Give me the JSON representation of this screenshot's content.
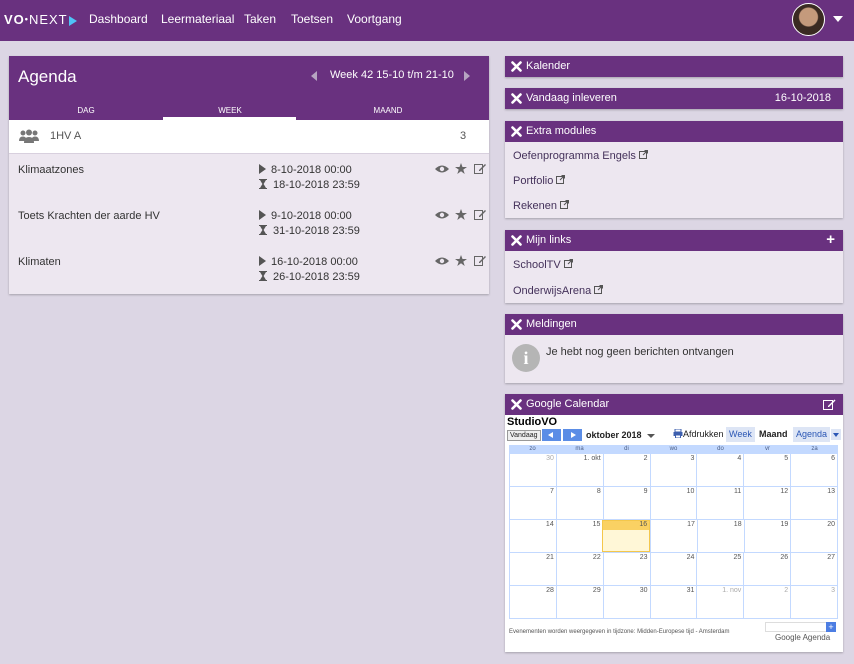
{
  "nav": {
    "logo_vo": "VO",
    "logo_next": "NEXT",
    "items": [
      "Dashboard",
      "Leermateriaal",
      "Taken",
      "Toetsen",
      "Voortgang"
    ]
  },
  "agenda": {
    "title": "Agenda",
    "week_label": "Week 42 15-10 t/m 21-10",
    "tabs": [
      "DAG",
      "WEEK",
      "MAAND"
    ],
    "active_tab": "WEEK",
    "group": {
      "name": "1HV A",
      "count": "3"
    },
    "items": [
      {
        "title": "Klimaatzones",
        "start": "8-10-2018 00:00",
        "end": "18-10-2018 23:59"
      },
      {
        "title": "Toets Krachten der aarde HV",
        "start": "9-10-2018 00:00",
        "end": "31-10-2018 23:59"
      },
      {
        "title": "Klimaten",
        "start": "16-10-2018 00:00",
        "end": "26-10-2018 23:59"
      }
    ]
  },
  "panels": {
    "kalender": {
      "title": "Kalender"
    },
    "inleveren": {
      "title": "Vandaag inleveren",
      "date": "16-10-2018"
    },
    "extra": {
      "title": "Extra modules",
      "links": [
        "Oefenprogramma Engels",
        "Portfolio",
        "Rekenen"
      ]
    },
    "mijnlinks": {
      "title": "Mijn links",
      "links": [
        "SchoolTV",
        "OnderwijsArena"
      ]
    },
    "meldingen": {
      "title": "Meldingen",
      "message": "Je hebt nog geen berichten ontvangen"
    },
    "google": {
      "title": "Google Calendar"
    }
  },
  "gcal": {
    "name": "StudioVO",
    "today_btn": "Vandaag",
    "month": "oktober 2018",
    "print": "Afdrukken",
    "views": [
      "Week",
      "Maand",
      "Agenda"
    ],
    "active_view": "Maand",
    "dow": [
      "zo",
      "ma",
      "di",
      "wo",
      "do",
      "vr",
      "za"
    ],
    "weeks": [
      [
        "30",
        "1. okt",
        "2",
        "3",
        "4",
        "5",
        "6"
      ],
      [
        "7",
        "8",
        "9",
        "10",
        "11",
        "12",
        "13"
      ],
      [
        "14",
        "15",
        "16",
        "17",
        "18",
        "19",
        "20"
      ],
      [
        "21",
        "22",
        "23",
        "24",
        "25",
        "26",
        "27"
      ],
      [
        "28",
        "29",
        "30",
        "31",
        "1. nov",
        "2",
        "3"
      ]
    ],
    "today": "16",
    "footer": "Evenementen worden weergegeven in tijdzone: Midden-Europese tijd - Amsterdam",
    "google_label": "Google Agenda",
    "add_label": "+"
  },
  "colors": {
    "brand": "#69317f",
    "background": "#dcd6e4",
    "panel": "#ede7f0"
  },
  "icons": [
    "users-icon",
    "play-icon",
    "hourglass-icon",
    "eye-icon",
    "star-icon",
    "edit-icon",
    "close-icon",
    "external-link-icon",
    "info-icon",
    "plus-icon",
    "print-icon"
  ]
}
